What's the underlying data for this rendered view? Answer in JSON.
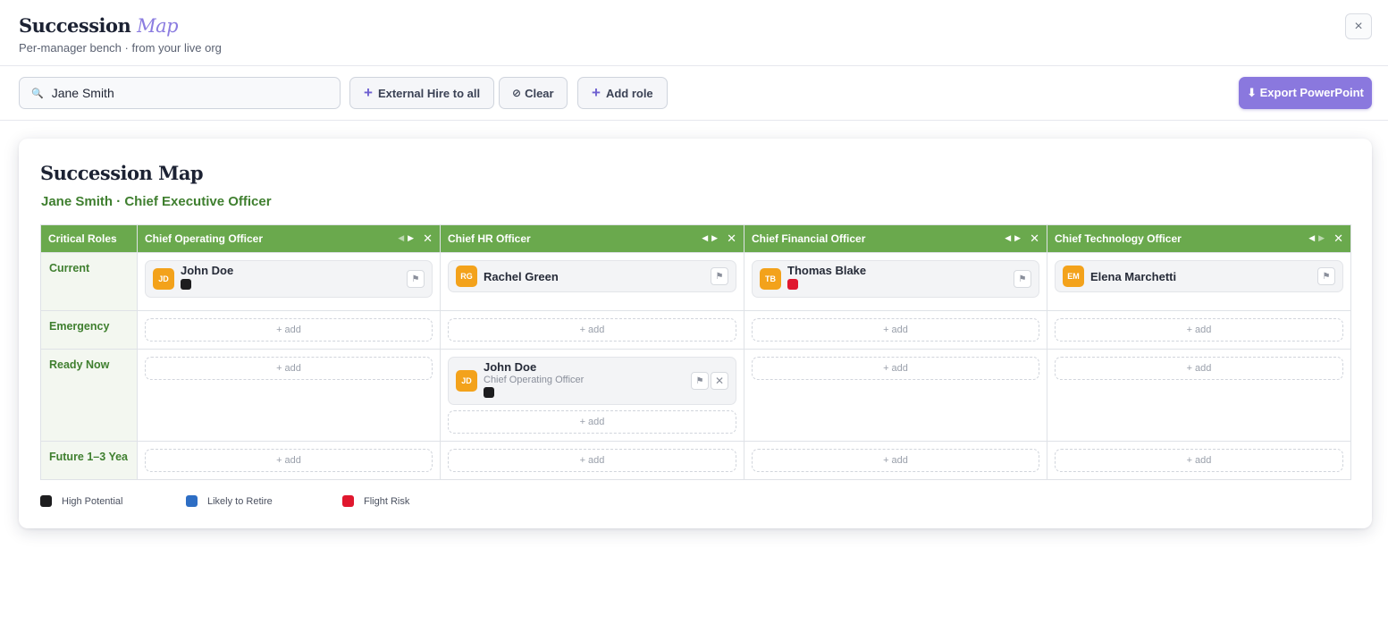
{
  "header": {
    "title_main": "Succession",
    "title_accent": "Map",
    "subtitle": "Per-manager bench · from your live org",
    "close_icon": "×"
  },
  "toolbar": {
    "search_value": "Jane Smith",
    "external_hire_label": "External Hire to all",
    "clear_label": "Clear",
    "add_role_label": "Add role",
    "export_label": "⬇ Export PowerPoint"
  },
  "card": {
    "title": "Succession Map",
    "subtitle": "Jane Smith · Chief Executive Officer"
  },
  "grid": {
    "corner_label": "Critical Roles",
    "columns": [
      {
        "title": "Chief Operating Officer"
      },
      {
        "title": "Chief HR Officer"
      },
      {
        "title": "Chief Financial Officer"
      },
      {
        "title": "Chief Technology Officer"
      }
    ],
    "rows": [
      {
        "label": "Current"
      },
      {
        "label": "Emergency"
      },
      {
        "label": "Ready Now"
      },
      {
        "label": "Future 1–3 Yea"
      }
    ],
    "add_label": "+ add",
    "current": [
      {
        "initials": "JD",
        "name": "John Doe",
        "status": "High Potential"
      },
      {
        "initials": "RG",
        "name": "Rachel Green"
      },
      {
        "initials": "TB",
        "name": "Thomas Blake",
        "status": "Flight Risk"
      },
      {
        "initials": "EM",
        "name": "Elena Marchetti"
      }
    ],
    "ready_now_hr": {
      "initials": "JD",
      "name": "John Doe",
      "title": "Chief Operating Officer",
      "status": "High Potential"
    }
  },
  "legend": [
    {
      "label": "High Potential",
      "color": "#1d1d1f"
    },
    {
      "label": "Likely to Retire",
      "color": "#2e6ec4"
    },
    {
      "label": "Flight Risk",
      "color": "#e0172e"
    }
  ],
  "colors": {
    "header_green": "#6aa94d",
    "accent_purple": "#8a78de",
    "avatar_orange": "#f3a21b",
    "row_label_green": "#3f7f2f"
  }
}
